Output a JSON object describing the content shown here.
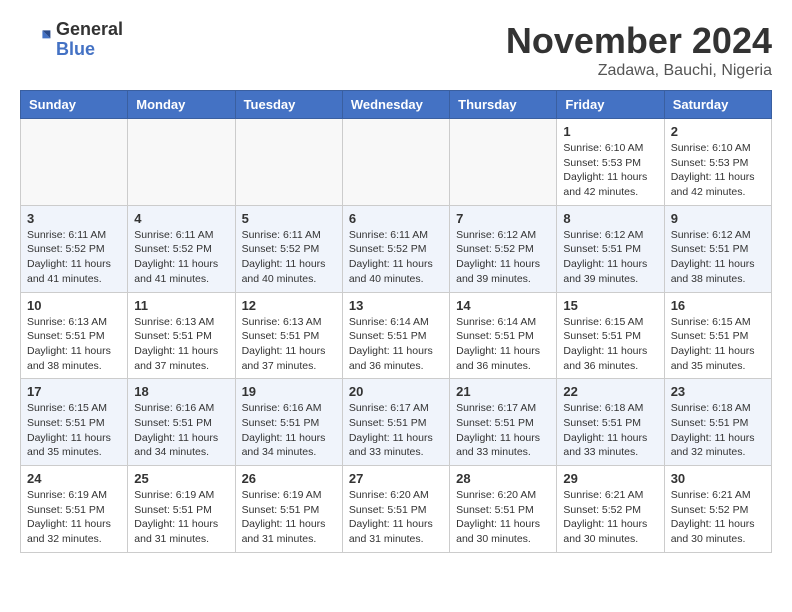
{
  "header": {
    "logo_general": "General",
    "logo_blue": "Blue",
    "month_title": "November 2024",
    "location": "Zadawa, Bauchi, Nigeria"
  },
  "weekdays": [
    "Sunday",
    "Monday",
    "Tuesday",
    "Wednesday",
    "Thursday",
    "Friday",
    "Saturday"
  ],
  "weeks": [
    [
      {
        "day": "",
        "empty": true
      },
      {
        "day": "",
        "empty": true
      },
      {
        "day": "",
        "empty": true
      },
      {
        "day": "",
        "empty": true
      },
      {
        "day": "",
        "empty": true
      },
      {
        "day": "1",
        "sunrise": "6:10 AM",
        "sunset": "5:53 PM",
        "daylight": "11 hours and 42 minutes."
      },
      {
        "day": "2",
        "sunrise": "6:10 AM",
        "sunset": "5:53 PM",
        "daylight": "11 hours and 42 minutes."
      }
    ],
    [
      {
        "day": "3",
        "sunrise": "6:11 AM",
        "sunset": "5:52 PM",
        "daylight": "11 hours and 41 minutes."
      },
      {
        "day": "4",
        "sunrise": "6:11 AM",
        "sunset": "5:52 PM",
        "daylight": "11 hours and 41 minutes."
      },
      {
        "day": "5",
        "sunrise": "6:11 AM",
        "sunset": "5:52 PM",
        "daylight": "11 hours and 40 minutes."
      },
      {
        "day": "6",
        "sunrise": "6:11 AM",
        "sunset": "5:52 PM",
        "daylight": "11 hours and 40 minutes."
      },
      {
        "day": "7",
        "sunrise": "6:12 AM",
        "sunset": "5:52 PM",
        "daylight": "11 hours and 39 minutes."
      },
      {
        "day": "8",
        "sunrise": "6:12 AM",
        "sunset": "5:51 PM",
        "daylight": "11 hours and 39 minutes."
      },
      {
        "day": "9",
        "sunrise": "6:12 AM",
        "sunset": "5:51 PM",
        "daylight": "11 hours and 38 minutes."
      }
    ],
    [
      {
        "day": "10",
        "sunrise": "6:13 AM",
        "sunset": "5:51 PM",
        "daylight": "11 hours and 38 minutes."
      },
      {
        "day": "11",
        "sunrise": "6:13 AM",
        "sunset": "5:51 PM",
        "daylight": "11 hours and 37 minutes."
      },
      {
        "day": "12",
        "sunrise": "6:13 AM",
        "sunset": "5:51 PM",
        "daylight": "11 hours and 37 minutes."
      },
      {
        "day": "13",
        "sunrise": "6:14 AM",
        "sunset": "5:51 PM",
        "daylight": "11 hours and 36 minutes."
      },
      {
        "day": "14",
        "sunrise": "6:14 AM",
        "sunset": "5:51 PM",
        "daylight": "11 hours and 36 minutes."
      },
      {
        "day": "15",
        "sunrise": "6:15 AM",
        "sunset": "5:51 PM",
        "daylight": "11 hours and 36 minutes."
      },
      {
        "day": "16",
        "sunrise": "6:15 AM",
        "sunset": "5:51 PM",
        "daylight": "11 hours and 35 minutes."
      }
    ],
    [
      {
        "day": "17",
        "sunrise": "6:15 AM",
        "sunset": "5:51 PM",
        "daylight": "11 hours and 35 minutes."
      },
      {
        "day": "18",
        "sunrise": "6:16 AM",
        "sunset": "5:51 PM",
        "daylight": "11 hours and 34 minutes."
      },
      {
        "day": "19",
        "sunrise": "6:16 AM",
        "sunset": "5:51 PM",
        "daylight": "11 hours and 34 minutes."
      },
      {
        "day": "20",
        "sunrise": "6:17 AM",
        "sunset": "5:51 PM",
        "daylight": "11 hours and 33 minutes."
      },
      {
        "day": "21",
        "sunrise": "6:17 AM",
        "sunset": "5:51 PM",
        "daylight": "11 hours and 33 minutes."
      },
      {
        "day": "22",
        "sunrise": "6:18 AM",
        "sunset": "5:51 PM",
        "daylight": "11 hours and 33 minutes."
      },
      {
        "day": "23",
        "sunrise": "6:18 AM",
        "sunset": "5:51 PM",
        "daylight": "11 hours and 32 minutes."
      }
    ],
    [
      {
        "day": "24",
        "sunrise": "6:19 AM",
        "sunset": "5:51 PM",
        "daylight": "11 hours and 32 minutes."
      },
      {
        "day": "25",
        "sunrise": "6:19 AM",
        "sunset": "5:51 PM",
        "daylight": "11 hours and 31 minutes."
      },
      {
        "day": "26",
        "sunrise": "6:19 AM",
        "sunset": "5:51 PM",
        "daylight": "11 hours and 31 minutes."
      },
      {
        "day": "27",
        "sunrise": "6:20 AM",
        "sunset": "5:51 PM",
        "daylight": "11 hours and 31 minutes."
      },
      {
        "day": "28",
        "sunrise": "6:20 AM",
        "sunset": "5:51 PM",
        "daylight": "11 hours and 30 minutes."
      },
      {
        "day": "29",
        "sunrise": "6:21 AM",
        "sunset": "5:52 PM",
        "daylight": "11 hours and 30 minutes."
      },
      {
        "day": "30",
        "sunrise": "6:21 AM",
        "sunset": "5:52 PM",
        "daylight": "11 hours and 30 minutes."
      }
    ]
  ]
}
